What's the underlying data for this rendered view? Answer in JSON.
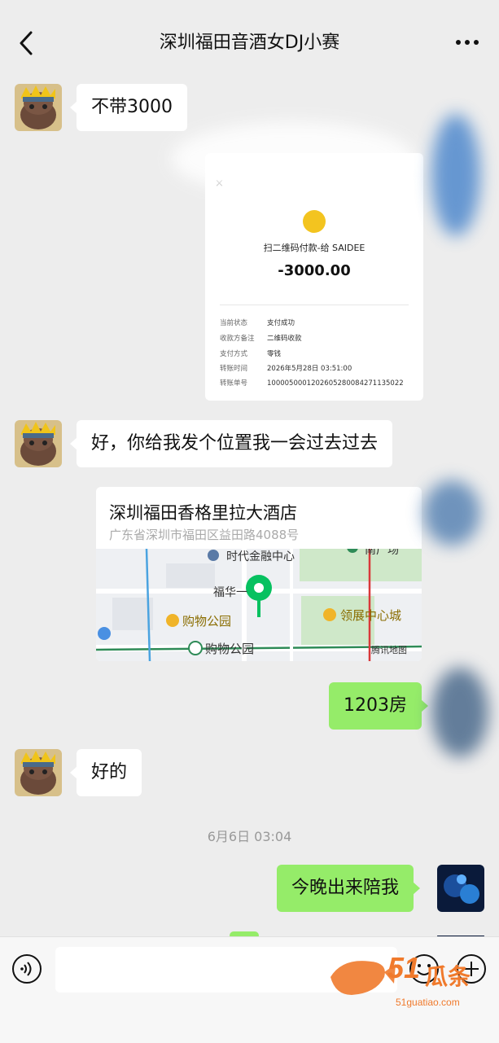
{
  "header": {
    "title": "深圳福田音酒女DJ小赛"
  },
  "messages": {
    "m1": "不带3000",
    "m2": "好，你给我发个位置我一会过去过去",
    "m3": "1203房",
    "m4": "好的",
    "m5": "今晚出来陪我"
  },
  "receipt": {
    "close": "×",
    "title": "扫二维码付款-给 SAIDEE",
    "amount": "-3000.00",
    "rows": [
      {
        "k": "当前状态",
        "v": "支付成功"
      },
      {
        "k": "收款方备注",
        "v": "二维码收款"
      },
      {
        "k": "支付方式",
        "v": "零钱"
      },
      {
        "k": "转账时间",
        "v": "2026年5月28日 03:51:00"
      },
      {
        "k": "转账单号",
        "v": "1000050001202605280084271135022"
      }
    ]
  },
  "location": {
    "name": "深圳福田香格里拉大酒店",
    "address": "广东省深圳市福田区益田路4088号",
    "map_labels": {
      "times": "时代金融中心",
      "fuhua": "福华一",
      "mall1": "购物公园",
      "lingzhan": "领展中心城",
      "mall2": "购物公园",
      "tencent": "腾讯地图",
      "plaza": "南广场"
    }
  },
  "timestamp": "6月6日 03:04",
  "watermark": {
    "num": "51",
    "cn": "瓜条",
    "url": "51guatiao.com"
  },
  "colors": {
    "out_bubble": "#95ec69",
    "background": "#ededed",
    "pin": "#07c160"
  }
}
